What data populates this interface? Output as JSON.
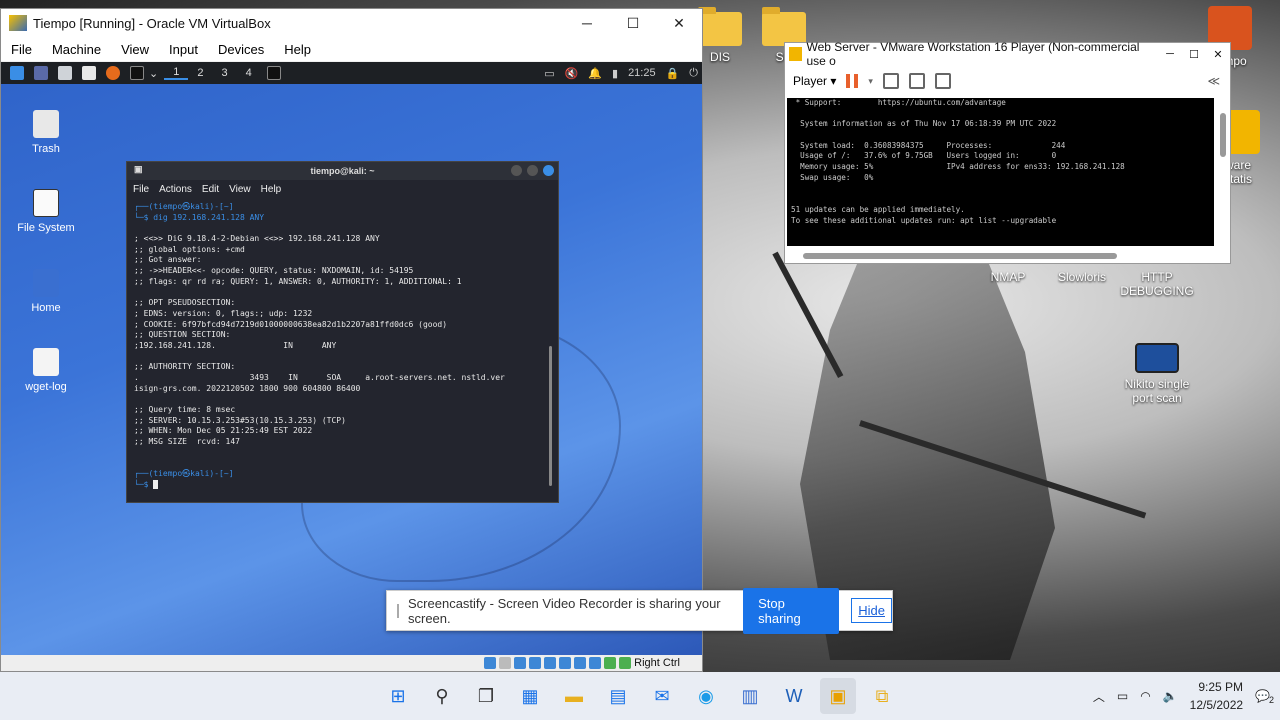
{
  "vbox": {
    "title": "Tiempo [Running] - Oracle VM VirtualBox",
    "menu": [
      "File",
      "Machine",
      "View",
      "Input",
      "Devices",
      "Help"
    ],
    "status_hostkey": "Right Ctrl"
  },
  "kali": {
    "panel": {
      "workspaces": [
        "1",
        "2",
        "3",
        "4"
      ],
      "time": "21:25"
    },
    "desktop_icons": [
      "Trash",
      "File System",
      "Home",
      "wget-log"
    ]
  },
  "terminal": {
    "title": "tiempo@kali: ~",
    "menu": [
      "File",
      "Actions",
      "Edit",
      "View",
      "Help"
    ],
    "lines": [
      "┌──(tiempo㉿kali)-[~]",
      "└─$ dig 192.168.241.128 ANY",
      "",
      "; <<>> DiG 9.18.4-2-Debian <<>> 192.168.241.128 ANY",
      ";; global options: +cmd",
      ";; Got answer:",
      ";; ->>HEADER<<- opcode: QUERY, status: NXDOMAIN, id: 54195",
      ";; flags: qr rd ra; QUERY: 1, ANSWER: 0, AUTHORITY: 1, ADDITIONAL: 1",
      "",
      ";; OPT PSEUDOSECTION:",
      "; EDNS: version: 0, flags:; udp: 1232",
      "; COOKIE: 6f97bfcd94d7219d01000000638ea82d1b2207a81ffd0dc6 (good)",
      ";; QUESTION SECTION:",
      ";192.168.241.128.              IN      ANY",
      "",
      ";; AUTHORITY SECTION:",
      ".                       3493    IN      SOA     a.root-servers.net. nstld.ver",
      "isign-grs.com. 2022120502 1800 900 604800 86400",
      "",
      ";; Query time: 8 msec",
      ";; SERVER: 10.15.3.253#53(10.15.3.253) (TCP)",
      ";; WHEN: Mon Dec 05 21:25:49 EST 2022",
      ";; MSG SIZE  rcvd: 147",
      "",
      "",
      "┌──(tiempo㉿kali)-[~]",
      "└─$ "
    ]
  },
  "vmware": {
    "title": "Web Server - VMware Workstation 16 Player (Non-commercial use o",
    "player_label": "Player",
    "console_lines": [
      " * Support:        https://ubuntu.com/advantage",
      "",
      "  System information as of Thu Nov 17 06:18:39 PM UTC 2022",
      "",
      "  System load:  0.36083984375     Processes:             244",
      "  Usage of /:   37.6% of 9.75GB   Users logged in:       0",
      "  Memory usage: 5%                IPv4 address for ens33: 192.168.241.128",
      "  Swap usage:   0%",
      "",
      "",
      "51 updates can be applied immediately.",
      "To see these additional updates run: apt list --upgradable"
    ]
  },
  "host_icons": [
    "DIS",
    "SC",
    "tempo",
    "ware",
    "statis",
    "NMAP",
    "Slowloris",
    "HTTP DEBUGGING",
    "Nikito single port scan"
  ],
  "screencastify": {
    "message": "Screencastify - Screen Video Recorder is sharing your screen.",
    "stop_label": "Stop sharing",
    "hide_label": "Hide"
  },
  "taskbar": {
    "time": "9:25 PM",
    "date": "12/5/2022",
    "notifications": "2"
  }
}
